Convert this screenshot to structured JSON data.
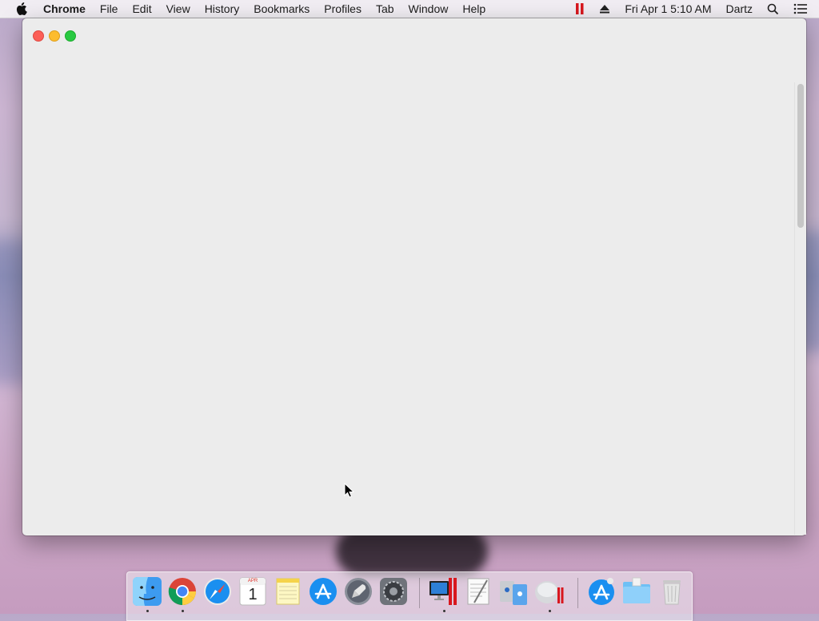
{
  "menubar": {
    "app_name": "Chrome",
    "items": [
      "File",
      "Edit",
      "View",
      "History",
      "Bookmarks",
      "Profiles",
      "Tab",
      "Window",
      "Help"
    ],
    "status": {
      "datetime": "Fri Apr 1  5:10 AM",
      "user": "Dartz"
    }
  },
  "window": {
    "title": ""
  },
  "dock": {
    "calendar_month": "APR",
    "calendar_day": "1",
    "apps": [
      "Finder",
      "Google Chrome",
      "Safari",
      "Calendar",
      "Notes",
      "App Store",
      "Launchpad",
      "System Preferences",
      "Parallels Windows",
      "TextEdit",
      "Migration Assistant",
      "Boot Camp",
      "App Store Downloads",
      "Folder",
      "Trash"
    ]
  },
  "colors": {
    "close": "#fc5f57",
    "minimize": "#fdbc2e",
    "maximize": "#28c941",
    "parallels_red": "#d8171e"
  }
}
